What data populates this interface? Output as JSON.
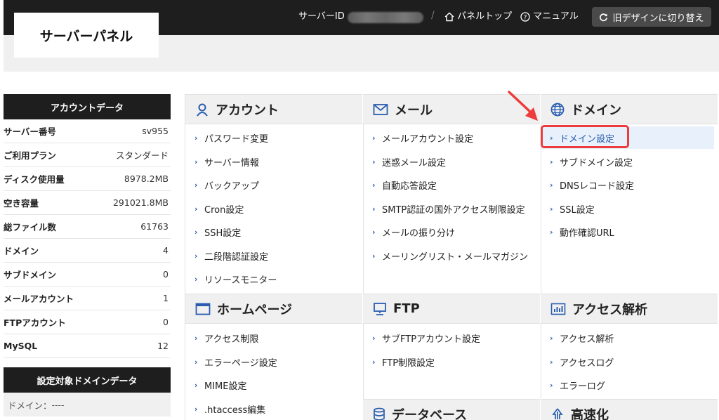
{
  "header": {
    "brand": "サーバーパネル",
    "server_id_label": "サーバーID",
    "separator": "/",
    "panel_top": "パネルトップ",
    "manual": "マニュアル",
    "old_design": "旧デザインに切り替え"
  },
  "sidebar": {
    "account_title": "アカウントデータ",
    "rows": [
      {
        "label": "サーバー番号",
        "value": "sv955"
      },
      {
        "label": "ご利用プラン",
        "value": "スタンダード"
      },
      {
        "label": "ディスク使用量",
        "value": "8978.2MB"
      },
      {
        "label": "空き容量",
        "value": "291021.8MB"
      },
      {
        "label": "総ファイル数",
        "value": "61763"
      },
      {
        "label": "ドメイン",
        "value": "4"
      },
      {
        "label": "サブドメイン",
        "value": "0"
      },
      {
        "label": "メールアカウント",
        "value": "1"
      },
      {
        "label": "FTPアカウント",
        "value": "0"
      },
      {
        "label": "MySQL",
        "value": "12"
      }
    ],
    "domain_title": "設定対象ドメインデータ",
    "domain_label": "ドメイン：",
    "domain_value": "----"
  },
  "sections": {
    "account": {
      "title": "アカウント",
      "links": [
        "パスワード変更",
        "サーバー情報",
        "バックアップ",
        "Cron設定",
        "SSH設定",
        "二段階認証設定",
        "リソースモニター"
      ]
    },
    "mail": {
      "title": "メール",
      "links": [
        "メールアカウント設定",
        "迷惑メール設定",
        "自動応答設定",
        "SMTP認証の国外アクセス制限設定",
        "メールの振り分け",
        "メーリングリスト・メールマガジン"
      ]
    },
    "domain": {
      "title": "ドメイン",
      "links": [
        "ドメイン設定",
        "サブドメイン設定",
        "DNSレコード設定",
        "SSL設定",
        "動作確認URL"
      ]
    },
    "homepage": {
      "title": "ホームページ",
      "links": [
        "アクセス制限",
        "エラーページ設定",
        "MIME設定",
        ".htaccess編集"
      ]
    },
    "ftp": {
      "title": "FTP",
      "links": [
        "サブFTPアカウント設定",
        "FTP制限設定"
      ]
    },
    "access": {
      "title": "アクセス解析",
      "links": [
        "アクセス解析",
        "アクセスログ",
        "エラーログ"
      ]
    },
    "database": {
      "title": "データベース"
    },
    "speed": {
      "title": "高速化"
    }
  },
  "colors": {
    "dark": "#1e1e1e",
    "accent": "#2a5db0",
    "highlight": "#ee3b3b"
  }
}
